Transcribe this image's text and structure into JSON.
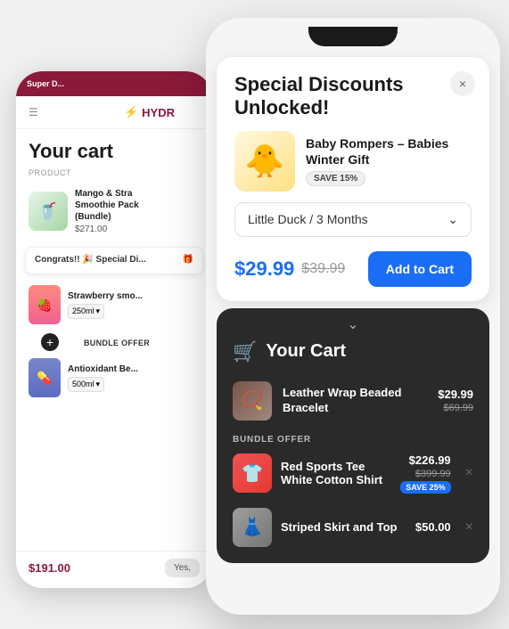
{
  "bg_phone": {
    "banner": "Super D...",
    "logo": "HYDR",
    "cart_title": "Your cart",
    "product_label": "PRODUCT",
    "product_name": "Mango & Stra\nSmoothie Pack\n(Bundle)",
    "product_price": "$271.00",
    "congrats_title": "Congrats!! 🎉 Special Di...",
    "strawberry_name": "Strawberry smo...",
    "strawberry_size": "250ml",
    "bundle_label": "BUNDLE OFFER",
    "antioxidant_name": "Antioxidant Be...",
    "antioxidant_size": "500ml",
    "total": "$191.00",
    "yes_btn": "Yes,"
  },
  "modal": {
    "title": "Special Discounts\nUnlocked!",
    "close_label": "×",
    "product": {
      "name": "Baby Rompers – Babies Winter Gift",
      "save_badge": "SAVE 15%",
      "emoji": "🐥"
    },
    "variant": {
      "label": "Little Duck / 3 Months",
      "chevron": "⌄"
    },
    "pricing": {
      "new_price": "$29.99",
      "old_price": "$39.99"
    },
    "add_btn": "Add to Cart"
  },
  "cart": {
    "title": "Your Cart",
    "cart_icon": "🛒",
    "collapse_arrow": "⌄",
    "items": [
      {
        "name": "Leather Wrap Beaded Bracelet",
        "price": "$29.99",
        "old_price": "$69.99",
        "emoji": "📿"
      }
    ],
    "bundle_offer_label": "BUNDLE OFFER",
    "bundle_items": [
      {
        "name": "Red Sports Tee",
        "name2": "White Cotton Shirt",
        "price": "$226.99",
        "old_price": "$399.99",
        "save_badge": "SAVE 25%",
        "emoji": "👕"
      }
    ],
    "skirt": {
      "name": "Striped Skirt and Top",
      "price": "$50.00",
      "emoji": "👗"
    }
  }
}
